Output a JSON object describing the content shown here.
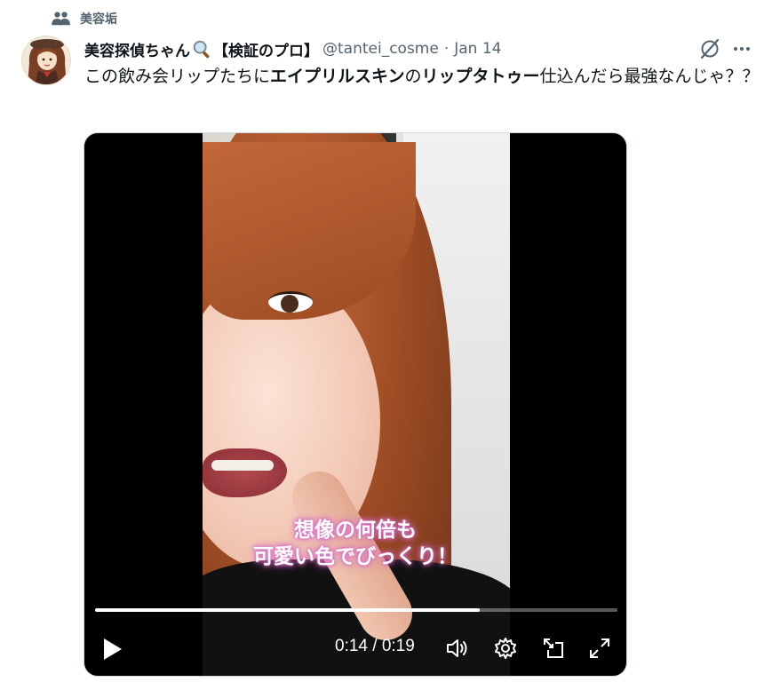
{
  "community": {
    "label": "美容垢",
    "icon": "community-icon"
  },
  "author": {
    "name": "美容探偵ちゃん",
    "name_suffix": "【検証のプロ】",
    "handle": "@tantei_cosme",
    "separator": "·",
    "date": "Jan 14"
  },
  "tweet": {
    "text_parts": [
      {
        "text": "この飲み会リップたちに"
      },
      {
        "text": "エイプリルスキン",
        "bold": true
      },
      {
        "text": "の"
      },
      {
        "text": "リップタトゥー",
        "bold": true
      },
      {
        "text": "仕込んだら最強なんじゃ？？"
      }
    ]
  },
  "video": {
    "caption_line1": "想像の何倍も",
    "caption_line2": "可愛い色でびっくり！",
    "time": "0:14 / 0:19",
    "progress": 0.7368
  },
  "icons": [
    "community-icon",
    "magnifier-emoji-icon",
    "grok-icon",
    "more-icon",
    "play-icon",
    "volume-icon",
    "settings-icon",
    "pip-icon",
    "fullscreen-icon"
  ],
  "colors": {
    "text": "#0f1419",
    "secondary": "#536471",
    "border": "#cfd9de"
  }
}
